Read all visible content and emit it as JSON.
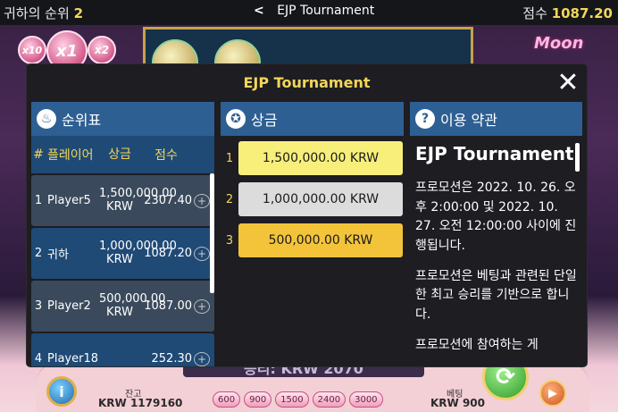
{
  "topbar": {
    "rank_label": "귀하의 순위",
    "rank_value": "2",
    "back_glyph": "<",
    "title": "EJP Tournament",
    "score_label": "점수",
    "score_value": "1087.20"
  },
  "game": {
    "multipliers": [
      "x10",
      "x1",
      "x2"
    ],
    "logo_text": "Moon",
    "win_text": "승리: KRW 2070",
    "balance_label": "잔고",
    "balance_value": "KRW 1179160",
    "bet_label": "베팅",
    "bet_value": "KRW 900",
    "chips": [
      "600",
      "900",
      "1500",
      "2400",
      "3000"
    ],
    "info_glyph": "i"
  },
  "modal": {
    "title": "EJP Tournament",
    "close_glyph": "✕",
    "leaderboard": {
      "title": "순위표",
      "columns": {
        "rank": "#",
        "player": "플레이어",
        "prize": "상금",
        "score": "점수"
      },
      "rows": [
        {
          "rank": "1",
          "player": "Player5",
          "prize": "1,500,000.00 KRW",
          "score": "2307.40"
        },
        {
          "rank": "2",
          "player": "귀하",
          "prize": "1,000,000.00 KRW",
          "score": "1087.20"
        },
        {
          "rank": "3",
          "player": "Player2",
          "prize": "500,000.00 KRW",
          "score": "1087.00"
        },
        {
          "rank": "4",
          "player": "Player18",
          "prize": "",
          "score": "252.30"
        }
      ]
    },
    "prizes": {
      "title": "상금",
      "items": [
        {
          "rank": "1",
          "amount": "1,500,000.00 KRW",
          "color": "#f7ef7a"
        },
        {
          "rank": "2",
          "amount": "1,000,000.00 KRW",
          "color": "#dcdcdc"
        },
        {
          "rank": "3",
          "amount": "500,000.00 KRW",
          "color": "#f3c43a"
        }
      ]
    },
    "terms": {
      "title": "이용 약관",
      "heading": "EJP Tournament",
      "paragraphs": [
        "프로모션은 2022. 10. 26. 오후 2:00:00 및 2022. 10. 27. 오전 12:00:00 사이에 진행됩니다.",
        "프로모션은 베팅과 관련된 단일한 최고 승리를 기반으로 합니다.",
        "프로모션에 참여하는 게"
      ]
    }
  },
  "colors": {
    "accent": "#f3d65a",
    "header_blue": "#2d5f93"
  }
}
